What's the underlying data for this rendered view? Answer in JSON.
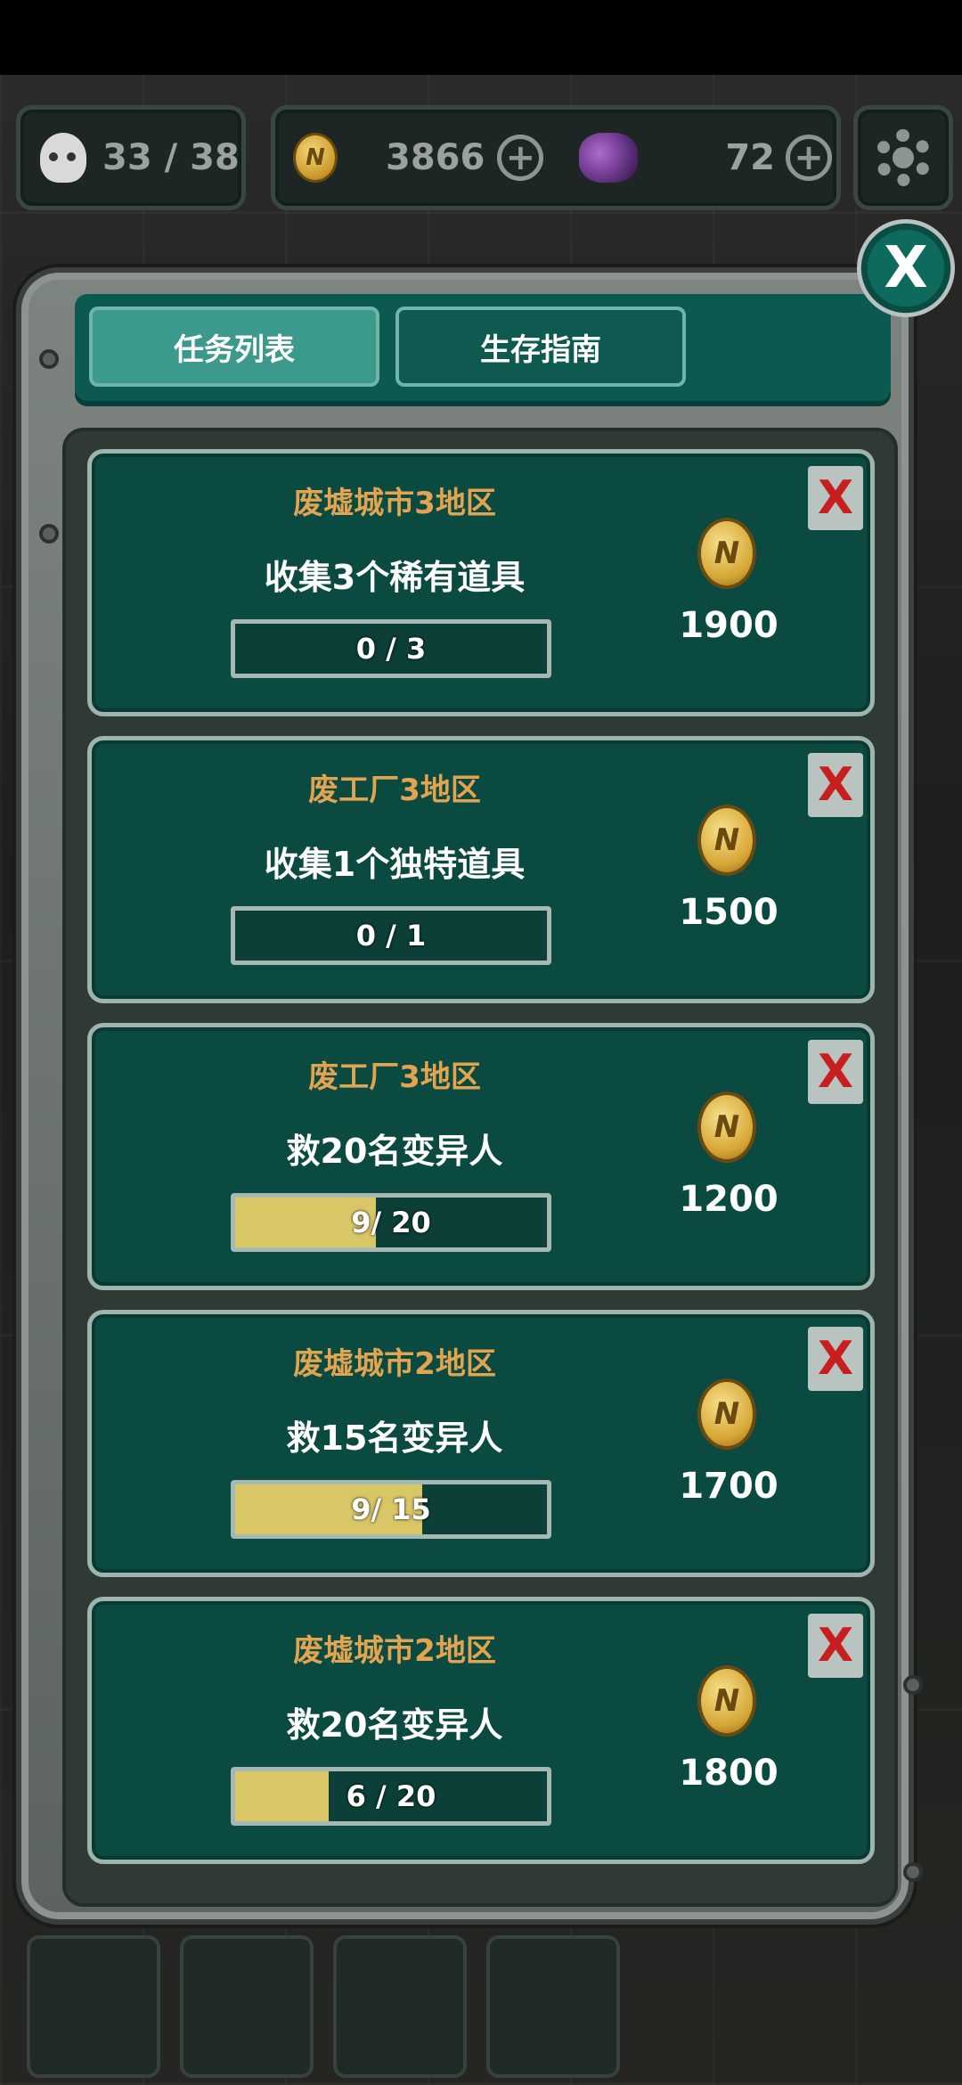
{
  "hud": {
    "population": "33 / 38",
    "coins": "3866",
    "coin_symbol": "N",
    "gems": "72"
  },
  "tabs": [
    {
      "label": "任务列表",
      "active": true
    },
    {
      "label": "生存指南",
      "active": false
    }
  ],
  "close_label": "X",
  "delete_label": "X",
  "tasks": [
    {
      "area": "废墟城市3地区",
      "description": "收集3个稀有道具",
      "progress_text": "0 / 3",
      "progress_fraction": 0.0,
      "reward": "1900"
    },
    {
      "area": "废工厂3地区",
      "description": "收集1个独特道具",
      "progress_text": "0 / 1",
      "progress_fraction": 0.0,
      "reward": "1500"
    },
    {
      "area": "废工厂3地区",
      "description": "救20名变异人",
      "progress_text": "9/ 20",
      "progress_fraction": 0.45,
      "reward": "1200"
    },
    {
      "area": "废墟城市2地区",
      "description": "救15名变异人",
      "progress_text": "9/ 15",
      "progress_fraction": 0.6,
      "reward": "1700"
    },
    {
      "area": "废墟城市2地区",
      "description": "救20名变异人",
      "progress_text": "6 / 20",
      "progress_fraction": 0.3,
      "reward": "1800"
    }
  ],
  "colors": {
    "card_bg": "#0b4a41",
    "area_text": "#e2a450",
    "progress_fill": "#d8c667",
    "delete_x": "#c71f1f"
  }
}
